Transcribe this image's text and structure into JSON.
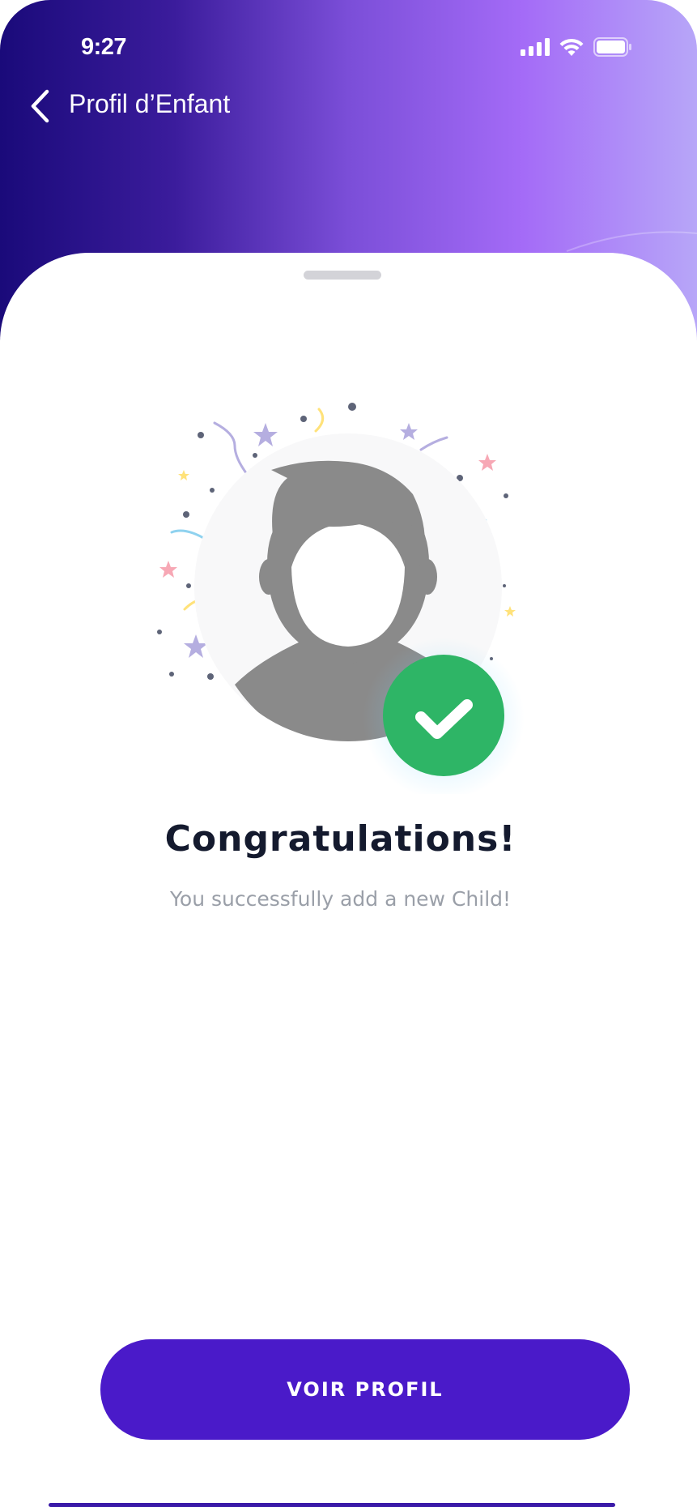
{
  "status_bar": {
    "time": "9:27",
    "icons": [
      "signal-icon",
      "wifi-icon",
      "battery-icon"
    ]
  },
  "nav": {
    "back_icon": "chevron-left-icon",
    "title": "Profil d’Enfant"
  },
  "success": {
    "avatar_icon": "person-silhouette-icon",
    "badge_icon": "check-icon",
    "title": "Congratulations!",
    "message": "You successfully add a new Child!"
  },
  "actions": {
    "view_profile_label": "VOIR PROFIL"
  },
  "colors": {
    "header_gradient_start": "#1a0a7a",
    "header_gradient_mid": "#a46bf7",
    "header_gradient_end": "#b7a6f8",
    "primary_button": "#4a1ac9",
    "success_green": "#2eb566",
    "title_text": "#141a2e",
    "subtitle_text": "#9a9fa8"
  }
}
